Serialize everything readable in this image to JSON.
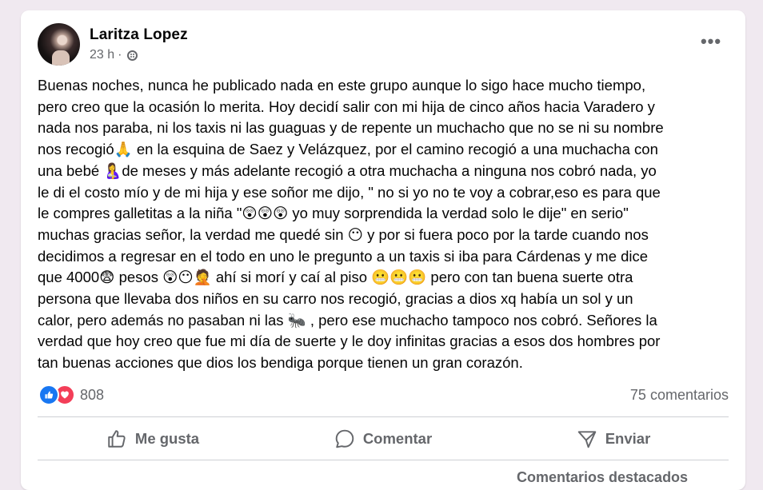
{
  "post": {
    "author": "Laritza Lopez",
    "time": "23 h",
    "separator": "·",
    "privacy_icon": "group-icon",
    "more_icon": "more-horizontal-icon",
    "more_label": "•••",
    "text": "Buenas noches, nunca he publicado nada en este grupo aunque lo sigo hace mucho tiempo,\npero creo que la ocasión lo merita. Hoy decidí salir con mi hija de cinco años hacia Varadero y\nnada nos paraba, ni los taxis ni las guaguas y de repente un muchacho que no se ni su nombre\nnos recogió🙏 en la esquina de Saez y Velázquez, por el camino recogió a una muchacha con\nuna bebé 🤱de meses y más adelante recogió a otra muchacha a ninguna nos cobró nada, yo\nle di el costo mío y de mi hija y ese soñor me dijo, \" no si yo no te voy a cobrar,eso es para que\nle compres galletitas a la niña \"😲😲😲 yo muy sorprendida la verdad solo le dije\" en serio\"\nmuchas gracias señor, la verdad me quedé sin 😶 y por si fuera poco por la tarde cuando nos\ndecidimos a regresar en el todo en uno le pregunto a un taxis si iba para Cárdenas y me dice\nque 4000😨 pesos 😲😶🤦 ahí si morí y caí al piso 😬😬😬 pero con tan buena suerte otra\npersona que llevaba dos niños en su carro nos recogió, gracias a dios xq había un sol y un\ncalor, pero además no pasaban ni las 🐜 , pero ese muchacho tampoco nos cobró. Señores la\nverdad que hoy creo que fue mi día de suerte y le doy infinitas gracias a esos dos hombres por\ntan buenas acciones que dios los bendiga porque tienen un gran corazón."
  },
  "stats": {
    "reaction_icons": [
      "like-icon",
      "love-icon"
    ],
    "reaction_count": "808",
    "comments_count": "75 comentarios"
  },
  "actions": {
    "like_label": "Me gusta",
    "comment_label": "Comentar",
    "share_label": "Enviar"
  },
  "footer": {
    "sort_label": "Comentarios destacados"
  },
  "colors": {
    "background": "#f0e9f0",
    "like_blue": "#1877f2",
    "love_red": "#f33e58",
    "secondary_text": "#65676b"
  }
}
